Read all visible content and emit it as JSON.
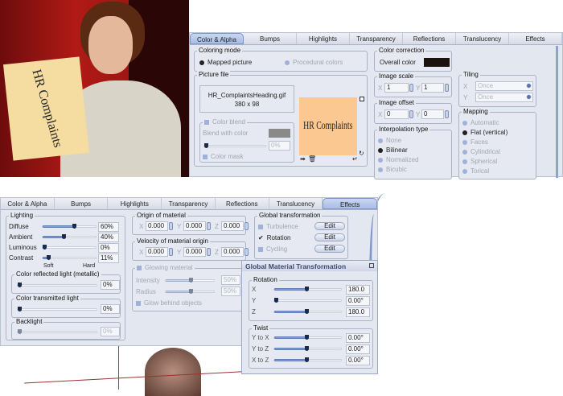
{
  "render_image": {
    "sign_text": "HR Complaints"
  },
  "top_panel": {
    "tabs": [
      "Color & Alpha",
      "Bumps",
      "Highlights",
      "Transparency",
      "Reflections",
      "Translucency",
      "Effects"
    ],
    "active_tab": "Color & Alpha",
    "coloring_mode": {
      "title": "Coloring mode",
      "options": [
        "Mapped picture",
        "Procedural colors"
      ],
      "selected": "Mapped picture"
    },
    "color_correction": {
      "title": "Color correction",
      "label": "Overall color",
      "color": "#1a120d"
    },
    "picture_file": {
      "title": "Picture file",
      "filename": "HR_ComplaintsHeading.gif",
      "dimensions": "380 x 98",
      "preview_text": "HR Complaints",
      "preview_color": "#fbc892"
    },
    "color_blend": {
      "title": "Color blend",
      "blend_label": "Blend with color",
      "blend_color": "#8a8a8a",
      "value": "0%",
      "mask_label": "Color mask"
    },
    "image_scale": {
      "title": "Image scale",
      "x_label": "X",
      "x": "1",
      "y_label": "Y",
      "y": "1"
    },
    "image_offset": {
      "title": "Image offset",
      "x_label": "X",
      "x": "0",
      "y_label": "Y",
      "y": "0"
    },
    "interpolation": {
      "title": "Interpolation type",
      "options": [
        "None",
        "Bilinear",
        "Normalized",
        "Bicubic"
      ],
      "selected": "Bilinear"
    },
    "tiling": {
      "title": "Tiling",
      "x_label": "X",
      "x": "Once",
      "y_label": "Y",
      "y": "Once"
    },
    "mapping": {
      "title": "Mapping",
      "options": [
        "Automatic",
        "Flat (vertical)",
        "Faces",
        "Cylindrical",
        "Spherical",
        "Torical"
      ],
      "selected": "Flat (vertical)"
    }
  },
  "bottom_panel": {
    "tabs": [
      "Color & Alpha",
      "Bumps",
      "Highlights",
      "Transparency",
      "Reflections",
      "Translucency",
      "Effects"
    ],
    "active_tab": "Effects",
    "lighting": {
      "title": "Lighting",
      "rows": [
        {
          "label": "Diffuse",
          "value": "60%",
          "pct": 60
        },
        {
          "label": "Ambient",
          "value": "40%",
          "pct": 40
        },
        {
          "label": "Luminous",
          "value": "0%",
          "pct": 0
        },
        {
          "label": "Contrast",
          "value": "11%",
          "pct": 11
        }
      ],
      "soft": "Soft",
      "hard": "Hard"
    },
    "reflected": {
      "title": "Color reflected light (metallic)",
      "value": "0%",
      "pct": 0
    },
    "transmitted": {
      "title": "Color transmitted light",
      "value": "0%",
      "pct": 0
    },
    "backlight": {
      "title": "Backlight",
      "value": "0%",
      "pct": 0
    },
    "origin": {
      "title": "Origin of material",
      "x": "0.000",
      "y": "0.000",
      "z": "0.000",
      "labels": [
        "X",
        "Y",
        "Z"
      ]
    },
    "velocity": {
      "title": "Velocity of material origin",
      "x": "0.000",
      "y": "0.000",
      "z": "0.000",
      "labels": [
        "X",
        "Y",
        "Z"
      ]
    },
    "glowing": {
      "title": "Glowing material",
      "intensity_label": "Intensity",
      "intensity": "50%",
      "radius_label": "Radius",
      "radius": "50%",
      "behind_label": "Glow behind objects"
    },
    "global_transformation": {
      "title": "Global transformation",
      "items": [
        {
          "label": "Turbulence",
          "checked": false,
          "button": "Edit"
        },
        {
          "label": "Rotation",
          "checked": true,
          "button": "Edit"
        },
        {
          "label": "Cycling",
          "checked": false,
          "button": "Edit"
        }
      ]
    }
  },
  "dialog": {
    "title": "Global Material Transformation",
    "rotation": {
      "title": "Rotation",
      "rows": [
        {
          "label": "X",
          "value": "180.0",
          "pct": 50
        },
        {
          "label": "Y",
          "value": "0.00°",
          "pct": 0
        },
        {
          "label": "Z",
          "value": "180.0",
          "pct": 50
        }
      ]
    },
    "twist": {
      "title": "Twist",
      "rows": [
        {
          "label": "Y to X",
          "value": "0.00°",
          "pct": 50
        },
        {
          "label": "Y to Z",
          "value": "0.00°",
          "pct": 50
        },
        {
          "label": "X to Z",
          "value": "0.00°",
          "pct": 50
        }
      ]
    }
  }
}
